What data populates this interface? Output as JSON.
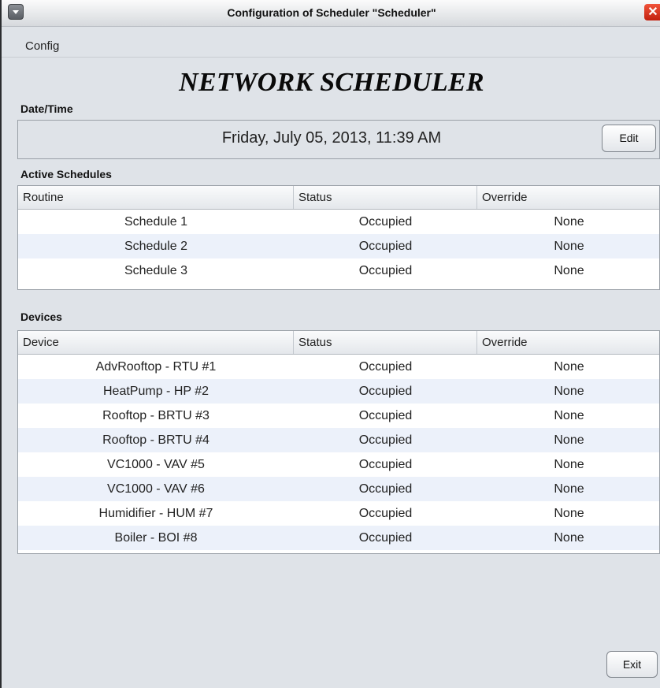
{
  "window": {
    "title": "Configuration of Scheduler \"Scheduler\"",
    "close_glyph": "✕"
  },
  "menu": {
    "config_label": "Config"
  },
  "app": {
    "title": "NETWORK SCHEDULER"
  },
  "datetime": {
    "section_label": "Date/Time",
    "value": "Friday, July 05, 2013, 11:39 AM",
    "edit_label": "Edit"
  },
  "schedules": {
    "section_label": "Active Schedules",
    "columns": [
      "Routine",
      "Status",
      "Override"
    ],
    "rows": [
      {
        "routine": "Schedule 1",
        "status": "Occupied",
        "override": "None"
      },
      {
        "routine": "Schedule 2",
        "status": "Occupied",
        "override": "None"
      },
      {
        "routine": "Schedule 3",
        "status": "Occupied",
        "override": "None"
      }
    ]
  },
  "devices": {
    "section_label": "Devices",
    "columns": [
      "Device",
      "Status",
      "Override"
    ],
    "rows": [
      {
        "device": "AdvRooftop - RTU #1",
        "status": "Occupied",
        "override": "None"
      },
      {
        "device": "HeatPump - HP #2",
        "status": "Occupied",
        "override": "None"
      },
      {
        "device": "Rooftop - BRTU #3",
        "status": "Occupied",
        "override": "None"
      },
      {
        "device": "Rooftop - BRTU #4",
        "status": "Occupied",
        "override": "None"
      },
      {
        "device": "VC1000 - VAV #5",
        "status": "Occupied",
        "override": "None"
      },
      {
        "device": "VC1000 - VAV #6",
        "status": "Occupied",
        "override": "None"
      },
      {
        "device": "Humidifier - HUM #7",
        "status": "Occupied",
        "override": "None"
      },
      {
        "device": "Boiler - BOI #8",
        "status": "Occupied",
        "override": "None"
      }
    ]
  },
  "footer": {
    "exit_label": "Exit"
  },
  "colors": {
    "window_bg": "#dfe3e8",
    "stripe": "#ecf1fa",
    "close": "#d83a22"
  }
}
